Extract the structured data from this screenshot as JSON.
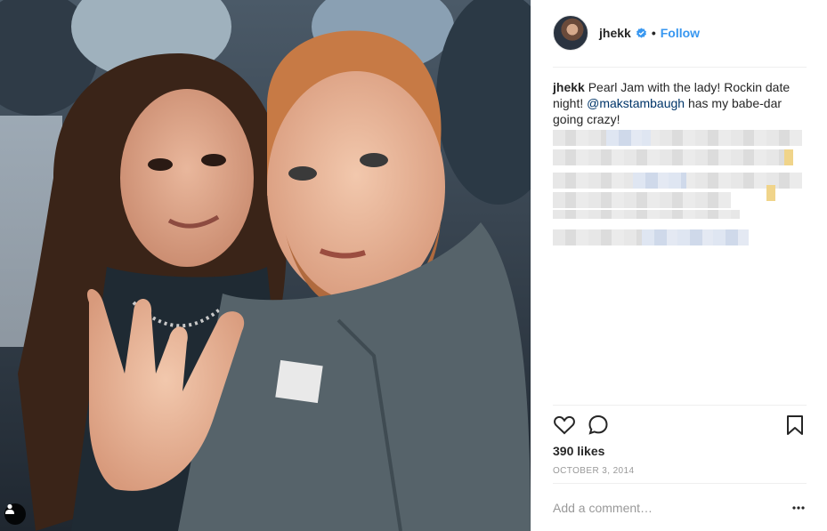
{
  "post": {
    "username": "jhekk",
    "follow_label": "Follow",
    "separator": "•",
    "caption_user": "jhekk",
    "caption_text_1": "Pearl Jam with the lady! Rockin date night!",
    "caption_mention": "@makstambaugh",
    "caption_text_2": "has my babe-dar going crazy!",
    "likes": "390 likes",
    "date": "OCTOBER 3, 2014",
    "comment_placeholder": "Add a comment…"
  },
  "icons": {
    "verified": "verified-badge-icon",
    "like": "heart-icon",
    "comment": "comment-bubble-icon",
    "save": "bookmark-icon",
    "more": "more-options-icon",
    "tag": "user-tag-icon"
  },
  "colors": {
    "follow": "#3897f0",
    "mention": "#003569",
    "verified": "#3897f0",
    "meta_text": "#999999"
  }
}
